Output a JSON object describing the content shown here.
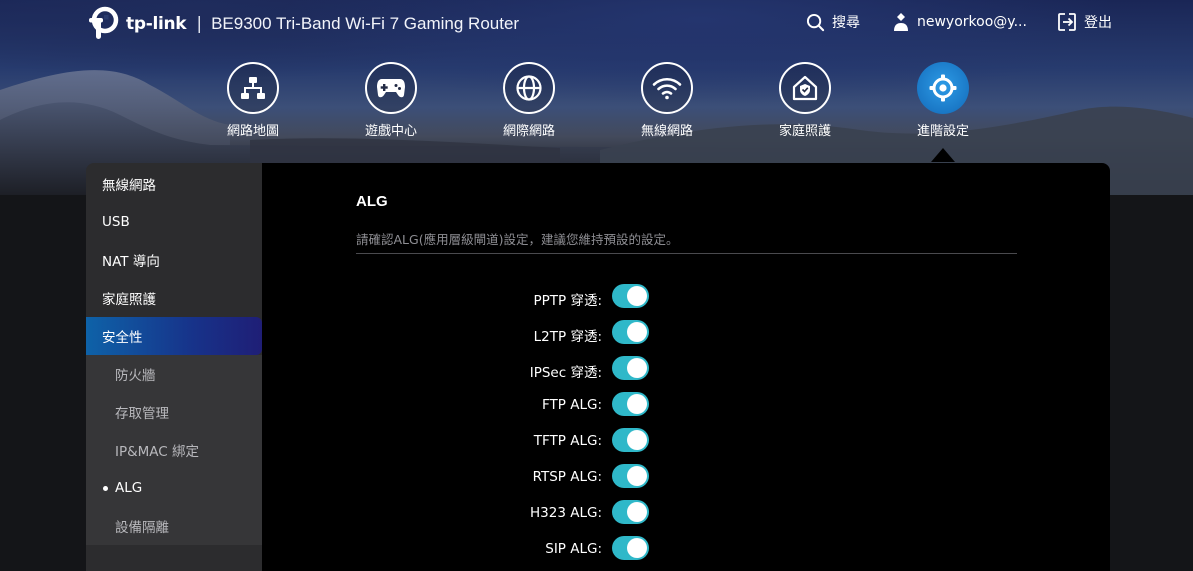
{
  "brand": {
    "name": "tp-link",
    "separator": "|",
    "model": "BE9300 Tri-Band Wi-Fi 7 Gaming Router"
  },
  "top_actions": {
    "search": "搜尋",
    "user": "newyorkoo@y...",
    "logout": "登出"
  },
  "nav": [
    {
      "label": "網路地圖",
      "icon": "network-map-icon",
      "active": false
    },
    {
      "label": "遊戲中心",
      "icon": "gamepad-icon",
      "active": false
    },
    {
      "label": "網際網路",
      "icon": "globe-icon",
      "active": false
    },
    {
      "label": "無線網路",
      "icon": "wifi-icon",
      "active": false
    },
    {
      "label": "家庭照護",
      "icon": "home-shield-icon",
      "active": false
    },
    {
      "label": "進階設定",
      "icon": "gear-icon",
      "active": true
    }
  ],
  "sidebar": {
    "items": [
      {
        "label": "無線網路"
      },
      {
        "label": "USB"
      },
      {
        "label": "NAT 導向"
      },
      {
        "label": "家庭照護"
      },
      {
        "label": "安全性",
        "active": true
      }
    ],
    "sub_items": [
      {
        "label": "防火牆"
      },
      {
        "label": "存取管理"
      },
      {
        "label": "IP&MAC 綁定"
      },
      {
        "label": "ALG",
        "current": true
      },
      {
        "label": "設備隔離"
      }
    ]
  },
  "section": {
    "title": "ALG",
    "description": "請確認ALG(應用層級閘道)設定，建議您維持預設的設定。"
  },
  "settings": [
    {
      "label": "PPTP 穿透:",
      "enabled": true
    },
    {
      "label": "L2TP 穿透:",
      "enabled": true
    },
    {
      "label": "IPSec 穿透:",
      "enabled": true
    },
    {
      "label": "FTP ALG:",
      "enabled": true
    },
    {
      "label": "TFTP ALG:",
      "enabled": true
    },
    {
      "label": "RTSP ALG:",
      "enabled": true
    },
    {
      "label": "H323 ALG:",
      "enabled": true
    },
    {
      "label": "SIP ALG:",
      "enabled": true
    }
  ],
  "colors": {
    "toggle_on": "#2fb8c9",
    "active_nav": "#1a78c6",
    "sidebar_active": "#17338a"
  }
}
